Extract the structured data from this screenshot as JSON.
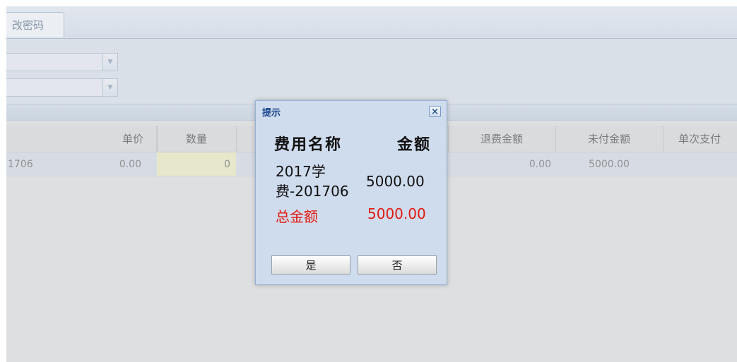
{
  "tabs": [
    {
      "label": "改密码"
    }
  ],
  "grid": {
    "headers": [
      "单价",
      "数量",
      "退费金额",
      "未付金额",
      "单次支付"
    ],
    "row": {
      "fee_name_fragment": "1706",
      "unit_price": "0.00",
      "quantity": "0",
      "refund_amount": "0.00",
      "unpaid_amount": "5000.00"
    }
  },
  "dialog": {
    "title": "提示",
    "header_name": "费用名称",
    "header_amount": "金额",
    "item_name_line1": "2017学",
    "item_name_line2": "费-201706",
    "item_amount": "5000.00",
    "total_label": "总金额",
    "total_amount": "5000.00",
    "yes_label": "是",
    "no_label": "否"
  },
  "colors": {
    "accent": "#15428b",
    "total_red": "#e3190f",
    "dialog_bg": "#cfdced"
  },
  "icons": {
    "close": "close-icon",
    "dropdown": "chevron-down-icon"
  }
}
